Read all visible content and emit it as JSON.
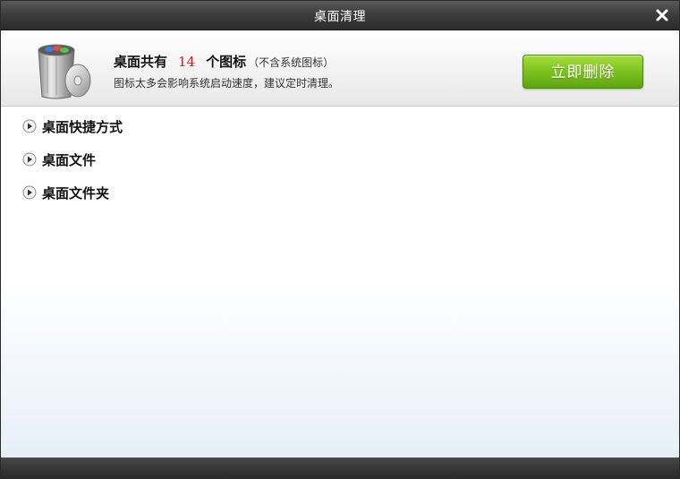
{
  "window": {
    "title": "桌面清理"
  },
  "header": {
    "prefix": "桌面共有",
    "count": "14",
    "suffix": "个图标",
    "note": "（不含系统图标）",
    "hint": "图标太多会影响系统启动速度，建议定时清理。",
    "action_label": "立即删除"
  },
  "categories": [
    {
      "label": "桌面快捷方式"
    },
    {
      "label": "桌面文件"
    },
    {
      "label": "桌面文件夹"
    }
  ],
  "colors": {
    "count": "#d9181b",
    "action_button": "#7cc21e",
    "titlebar": "#3d3d3d"
  },
  "icons": {
    "close": "close-icon",
    "trash": "trash-bin-icon",
    "expand": "expand-arrow-icon"
  }
}
